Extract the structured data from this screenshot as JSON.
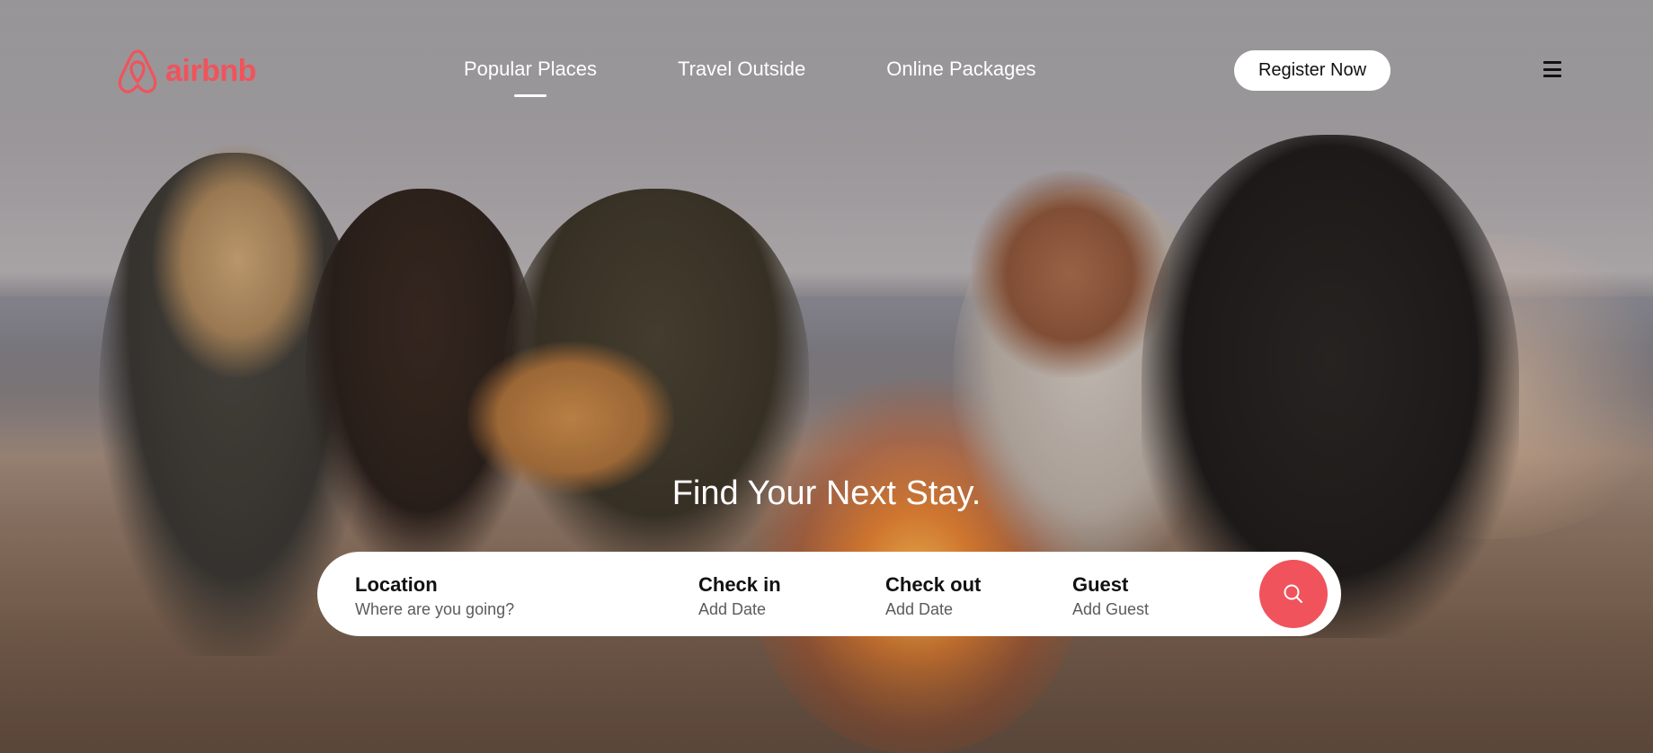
{
  "brand": {
    "name": "airbnb",
    "color": "#f0535c",
    "icon": "airbnb-logo-icon"
  },
  "nav": {
    "items": [
      {
        "label": "Popular Places",
        "active": true
      },
      {
        "label": "Travel Outside",
        "active": false
      },
      {
        "label": "Online Packages",
        "active": false
      }
    ]
  },
  "header": {
    "register_label": "Register Now",
    "menu_icon": "hamburger-menu-icon"
  },
  "hero": {
    "headline": "Find Your Next Stay."
  },
  "search": {
    "location": {
      "label": "Location",
      "placeholder": "Where are you going?"
    },
    "check_in": {
      "label": "Check in",
      "value": "Add Date"
    },
    "check_out": {
      "label": "Check out",
      "value": "Add Date"
    },
    "guest": {
      "label": "Guest",
      "value": "Add Guest"
    },
    "button_icon": "search-icon",
    "button_color": "#f0535c"
  }
}
